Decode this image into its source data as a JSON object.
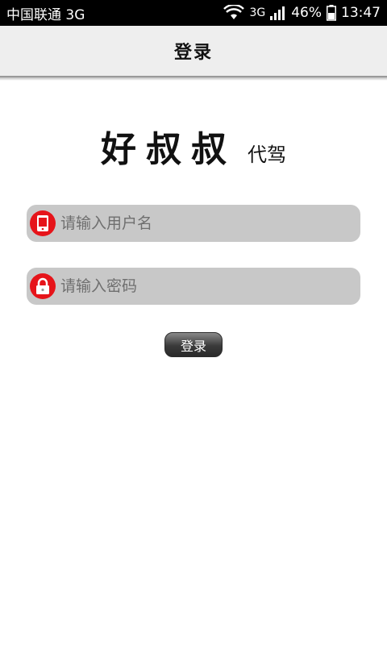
{
  "status_bar": {
    "carrier": "中国联通 3G",
    "network": "3G",
    "battery": "46%",
    "time": "13:47"
  },
  "nav": {
    "title": "登录"
  },
  "brand": {
    "name": "好叔叔",
    "subtitle": "代驾"
  },
  "form": {
    "username": {
      "placeholder": "请输入用户名",
      "value": ""
    },
    "password": {
      "placeholder": "请输入密码",
      "value": ""
    },
    "login_label": "登录"
  },
  "colors": {
    "icon_red": "#e6141a",
    "field_bg": "#c8c8c8",
    "nav_bg": "#eeeeee"
  },
  "icons": [
    "phone-icon",
    "lock-icon",
    "wifi-icon",
    "signal-icon",
    "battery-icon"
  ]
}
